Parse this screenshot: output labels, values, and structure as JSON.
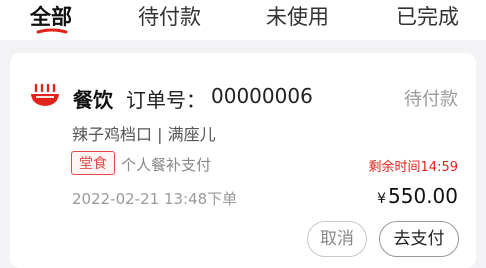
{
  "tabs": [
    {
      "label": "全部",
      "active": true
    },
    {
      "label": "待付款",
      "active": false
    },
    {
      "label": "未使用",
      "active": false
    },
    {
      "label": "已完成",
      "active": false
    }
  ],
  "colors": {
    "accent": "#e2231a",
    "tag_border": "#e04a4a",
    "muted_text": "#9a9a9a",
    "background": "#f3f3f5"
  },
  "order": {
    "category": "餐饮",
    "order_label": "订单号：",
    "order_number": "00000006",
    "status": "待付款",
    "merchant": "辣子鸡档口 | 满座儿",
    "tag": "堂食",
    "pay_type": "个人餐补支付",
    "countdown_label": "剩余时间",
    "countdown_value": "14:59",
    "time": "2022-02-21  13:48下单",
    "currency": "¥",
    "amount": "550.00",
    "icon": "restaurant-bowl-icon",
    "actions": {
      "cancel": "取消",
      "pay": "去支付"
    }
  }
}
